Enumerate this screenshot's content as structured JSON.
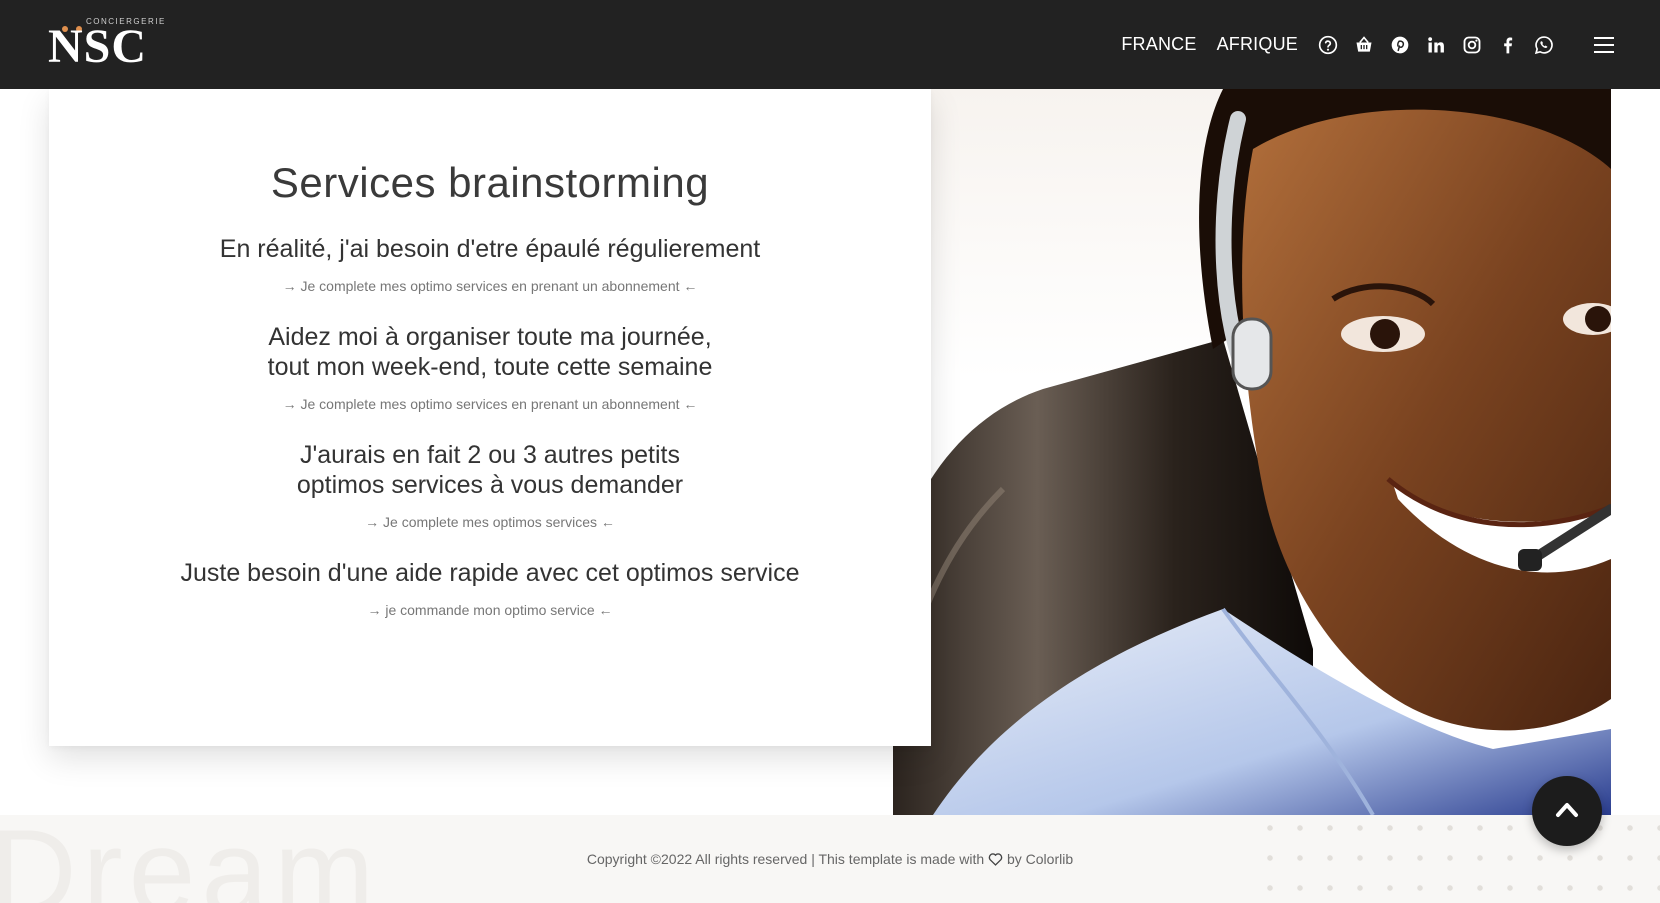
{
  "header": {
    "logo_small": "CONCIERGERIE",
    "logo_big": "NSC",
    "nav": [
      "FRANCE",
      "AFRIQUE"
    ],
    "icons": [
      "help-icon",
      "basket-icon",
      "pinterest-icon",
      "linkedin-icon",
      "instagram-icon",
      "facebook-icon",
      "whatsapp-icon",
      "menu-icon"
    ]
  },
  "main": {
    "title": "Services brainstorming",
    "blocks": [
      {
        "lines": [
          "En réalité, j'ai besoin d'etre épaulé régulierement"
        ],
        "link": "→ Je complete mes optimo services en prenant un abonnement ←"
      },
      {
        "lines": [
          "Aidez moi à organiser toute ma journée,",
          "tout mon week-end, toute cette semaine"
        ],
        "link": "→ Je complete mes optimo services en prenant un abonnement ←"
      },
      {
        "lines": [
          "J'aurais en fait 2 ou 3 autres petits",
          "optimos services à vous demander"
        ],
        "link": "→ Je complete mes optimos services ←"
      },
      {
        "lines": [
          "Juste besoin d'une aide rapide avec cet optimos service"
        ],
        "link": "→ je commande mon optimo service ←"
      }
    ]
  },
  "footer": {
    "ghost_text": "Dream",
    "copy_before": "Copyright ©2022 All rights reserved | This template is made with",
    "copy_after": "by Colorlib"
  },
  "colors": {
    "header_bg": "#222222",
    "footer_bg": "#f8f7f5",
    "backtop_bg": "#1c1c1c"
  }
}
